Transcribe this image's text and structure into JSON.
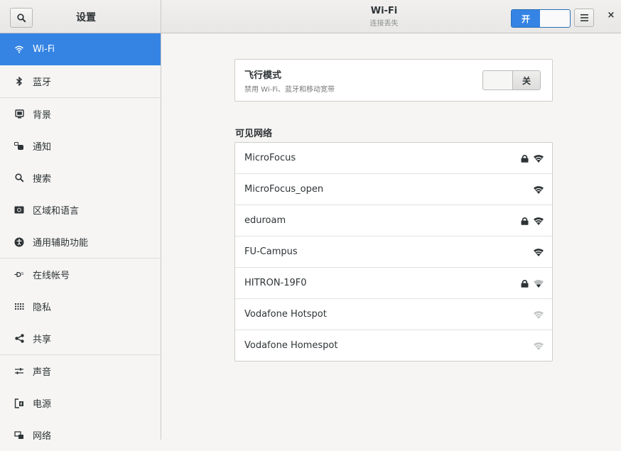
{
  "header": {
    "app_title": "设置",
    "page_title": "Wi-Fi",
    "page_subtitle": "连接丢失",
    "wifi_switch_label": "开",
    "menu_icon": "hamburger-icon",
    "close_label": "×"
  },
  "sidebar": {
    "items": [
      {
        "label": "Wi-Fi",
        "icon": "wifi-icon"
      },
      {
        "label": "蓝牙",
        "icon": "bluetooth-icon"
      },
      {
        "label": "背景",
        "icon": "background-icon"
      },
      {
        "label": "通知",
        "icon": "notifications-icon"
      },
      {
        "label": "搜索",
        "icon": "search-icon"
      },
      {
        "label": "区域和语言",
        "icon": "region-icon"
      },
      {
        "label": "通用辅助功能",
        "icon": "accessibility-icon"
      },
      {
        "label": "在线帐号",
        "icon": "online-accounts-icon"
      },
      {
        "label": "隐私",
        "icon": "privacy-icon"
      },
      {
        "label": "共享",
        "icon": "share-icon"
      },
      {
        "label": "声音",
        "icon": "sound-icon"
      },
      {
        "label": "电源",
        "icon": "power-icon"
      },
      {
        "label": "网络",
        "icon": "network-icon"
      }
    ]
  },
  "airplane": {
    "title": "飞行模式",
    "subtitle": "禁用 Wi-Fi、蓝牙和移动宽带",
    "switch_label": "关"
  },
  "networks_heading": "可见网络",
  "networks": [
    {
      "name": "MicroFocus",
      "secured": true,
      "signal": "strong"
    },
    {
      "name": "MicroFocus_open",
      "secured": false,
      "signal": "strong"
    },
    {
      "name": "eduroam",
      "secured": true,
      "signal": "strong"
    },
    {
      "name": "FU-Campus",
      "secured": false,
      "signal": "strong"
    },
    {
      "name": "HITRON-19F0",
      "secured": true,
      "signal": "weak"
    },
    {
      "name": "Vodafone Hotspot",
      "secured": false,
      "signal": "weak"
    },
    {
      "name": "Vodafone Homespot",
      "secured": false,
      "signal": "weak"
    }
  ],
  "colors": {
    "accent": "#3584e4",
    "text": "#2e3436"
  }
}
